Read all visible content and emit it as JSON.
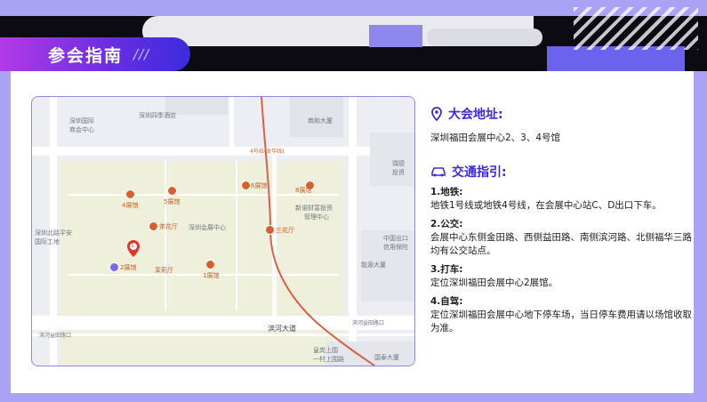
{
  "header": {
    "title": "参会指南",
    "slashes": "///"
  },
  "map": {
    "labels": {
      "poi1": "深圳国际",
      "poi1b": "商会中心",
      "hotel": "深圳四季酒店",
      "poi2": "商和大厦",
      "metro_line": "4号线(龙华线)",
      "center": "深圳会展中心",
      "finance1": "新诺财富投资",
      "finance2": "管理中心",
      "dadao": "滨河大道",
      "station1": "滨河益田路口",
      "station2": "滨河益田路口",
      "road1": "皇岗上围",
      "road2": "一村上围路",
      "china": "中国出口",
      "china2": "信用保险",
      "energy": "能源大厦",
      "cathay": "国泰大厦",
      "futian1": "福田",
      "west1": "深圳北路平安",
      "west2": "国际工地",
      "right1": "瑞德",
      "right2": "投资",
      "tianfu": "天虹大"
    },
    "halls": {
      "h4": "4展馆",
      "h5": "5展馆",
      "h6": "6展馆",
      "h8": "8展馆",
      "h2": "2展馆",
      "h1": "1展馆",
      "tea": "茶花厅",
      "lan": "兰花厅",
      "molihua": "茉莉厅"
    },
    "marker": "1"
  },
  "venue": {
    "heading": "大会地址:",
    "address": "深圳福田会展中心2、3、4号馆"
  },
  "transport": {
    "heading": "交通指引:",
    "items": [
      {
        "title": "1.地铁:",
        "text": "地铁1号线或地铁4号线，在会展中心站C、D出口下车。"
      },
      {
        "title": "2.公交:",
        "text": "会展中心东侧金田路、西侧益田路、南侧滨河路、北侧福华三路均有公交站点。"
      },
      {
        "title": "3.打车:",
        "text": "定位深圳福田会展中心2展馆。"
      },
      {
        "title": "4.自驾:",
        "text": "定位深圳福田会展中心地下停车场，当日停车费用请以场馆收取为准。"
      }
    ]
  },
  "colors": {
    "accent": "#3a2bd6",
    "hall": "#d9602d",
    "marker": "#e5332a",
    "metro": "#d6614b"
  }
}
